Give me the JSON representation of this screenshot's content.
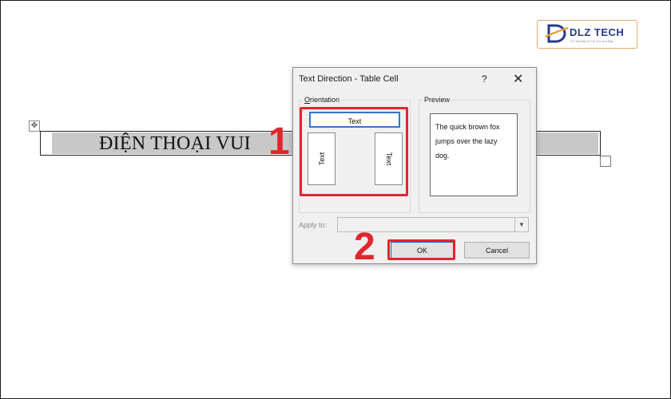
{
  "logo": {
    "name": "DLZ TECH",
    "tagline": "Cơ hội Bạn là Tài Trợ cho Bạn"
  },
  "document": {
    "cell_text": "ĐIỆN THOẠI VUI"
  },
  "dialog": {
    "title": "Text Direction - Table Cell",
    "help": "?",
    "close": "✕",
    "orientation_label_first": "O",
    "orientation_label_rest": "rientation",
    "orientation_options": [
      "Text",
      "Text",
      "Text"
    ],
    "preview_label": "Preview",
    "preview_text": "The quick brown fox jumps over the lazy dog.",
    "apply_label": "Apply to:",
    "apply_value": "",
    "ok_label": "OK",
    "cancel_label": "Cancel"
  },
  "annotations": {
    "step1": "1",
    "step2": "2",
    "highlight_color": "#e0262e"
  },
  "icons": {
    "move": "move-handle-icon",
    "close": "close-icon",
    "dropdown": "chevron-down-icon"
  }
}
